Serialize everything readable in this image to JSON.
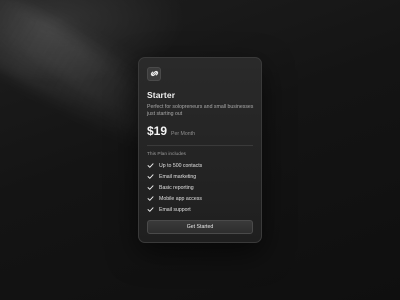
{
  "plan": {
    "icon": "link-icon",
    "name": "Starter",
    "description": "Perfect for solopreneurs and small businesses just starting out",
    "price": "$19",
    "period": "Per Month",
    "includes_label": "This Plan includes",
    "features": [
      {
        "icon": "check-icon",
        "label": "Up to 500 contacts"
      },
      {
        "icon": "check-icon",
        "label": "Email marketing"
      },
      {
        "icon": "check-icon",
        "label": "Basic reporting"
      },
      {
        "icon": "check-icon",
        "label": "Mobile app access"
      },
      {
        "icon": "check-icon",
        "label": "Email support"
      }
    ],
    "cta_label": "Get Started"
  },
  "colors": {
    "background": "#121212",
    "card": "#262626",
    "text": "#f2f2f2",
    "muted": "#a9a9a9",
    "button": "#333333"
  }
}
